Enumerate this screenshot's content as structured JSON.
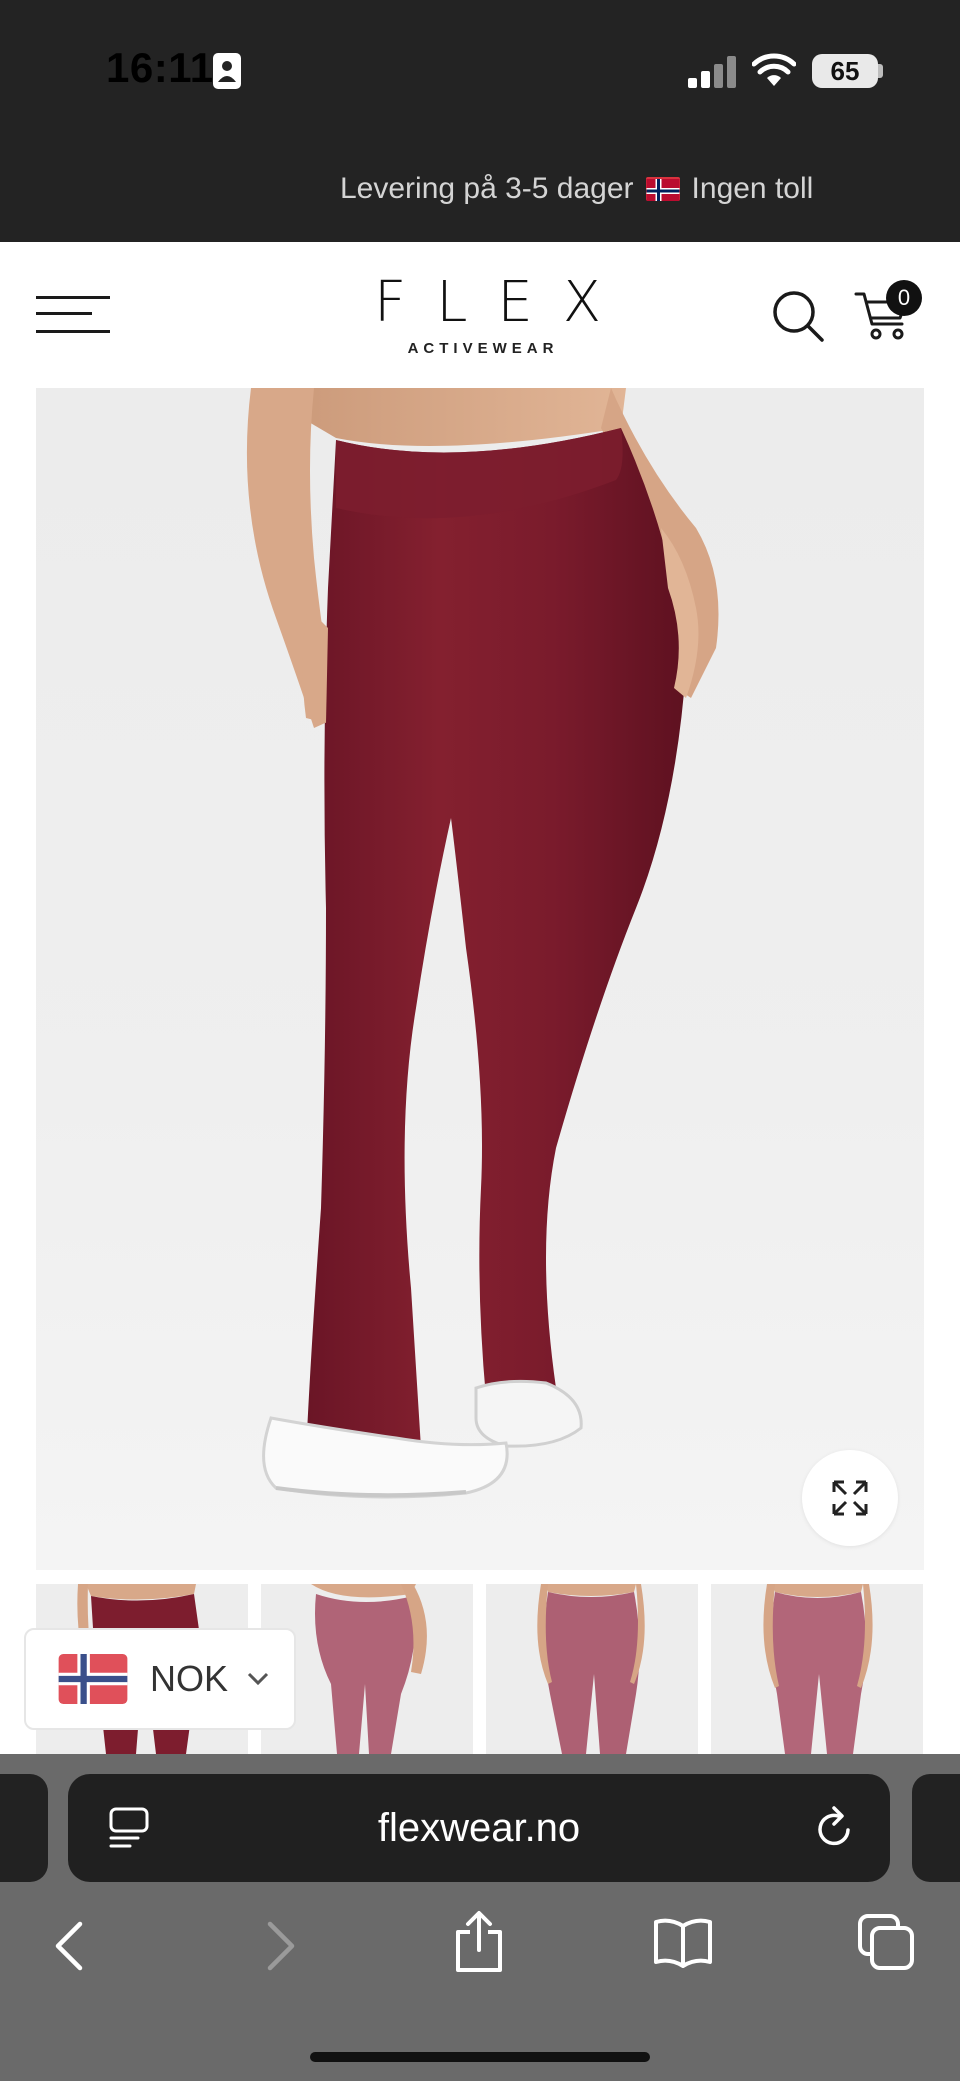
{
  "status_bar": {
    "time": "16:11",
    "battery": "65"
  },
  "announcement": {
    "text": "Levering på 3-5 dager",
    "suffix": "Ingen toll"
  },
  "header": {
    "logo": "FLEX",
    "logo_sub": "ACTIVEWEAR",
    "cart_count": "0"
  },
  "product": {
    "image_icon": "flared-leggings-photo",
    "color": "#7d1d2e",
    "thumbnails": [
      "front-view",
      "back-view-1",
      "back-view-2",
      "back-view-3"
    ]
  },
  "currency": {
    "label": "NOK"
  },
  "browser": {
    "url": "flexwear.no"
  },
  "colors": {
    "chrome_dark": "#232323",
    "product": "#7d1d2e"
  }
}
